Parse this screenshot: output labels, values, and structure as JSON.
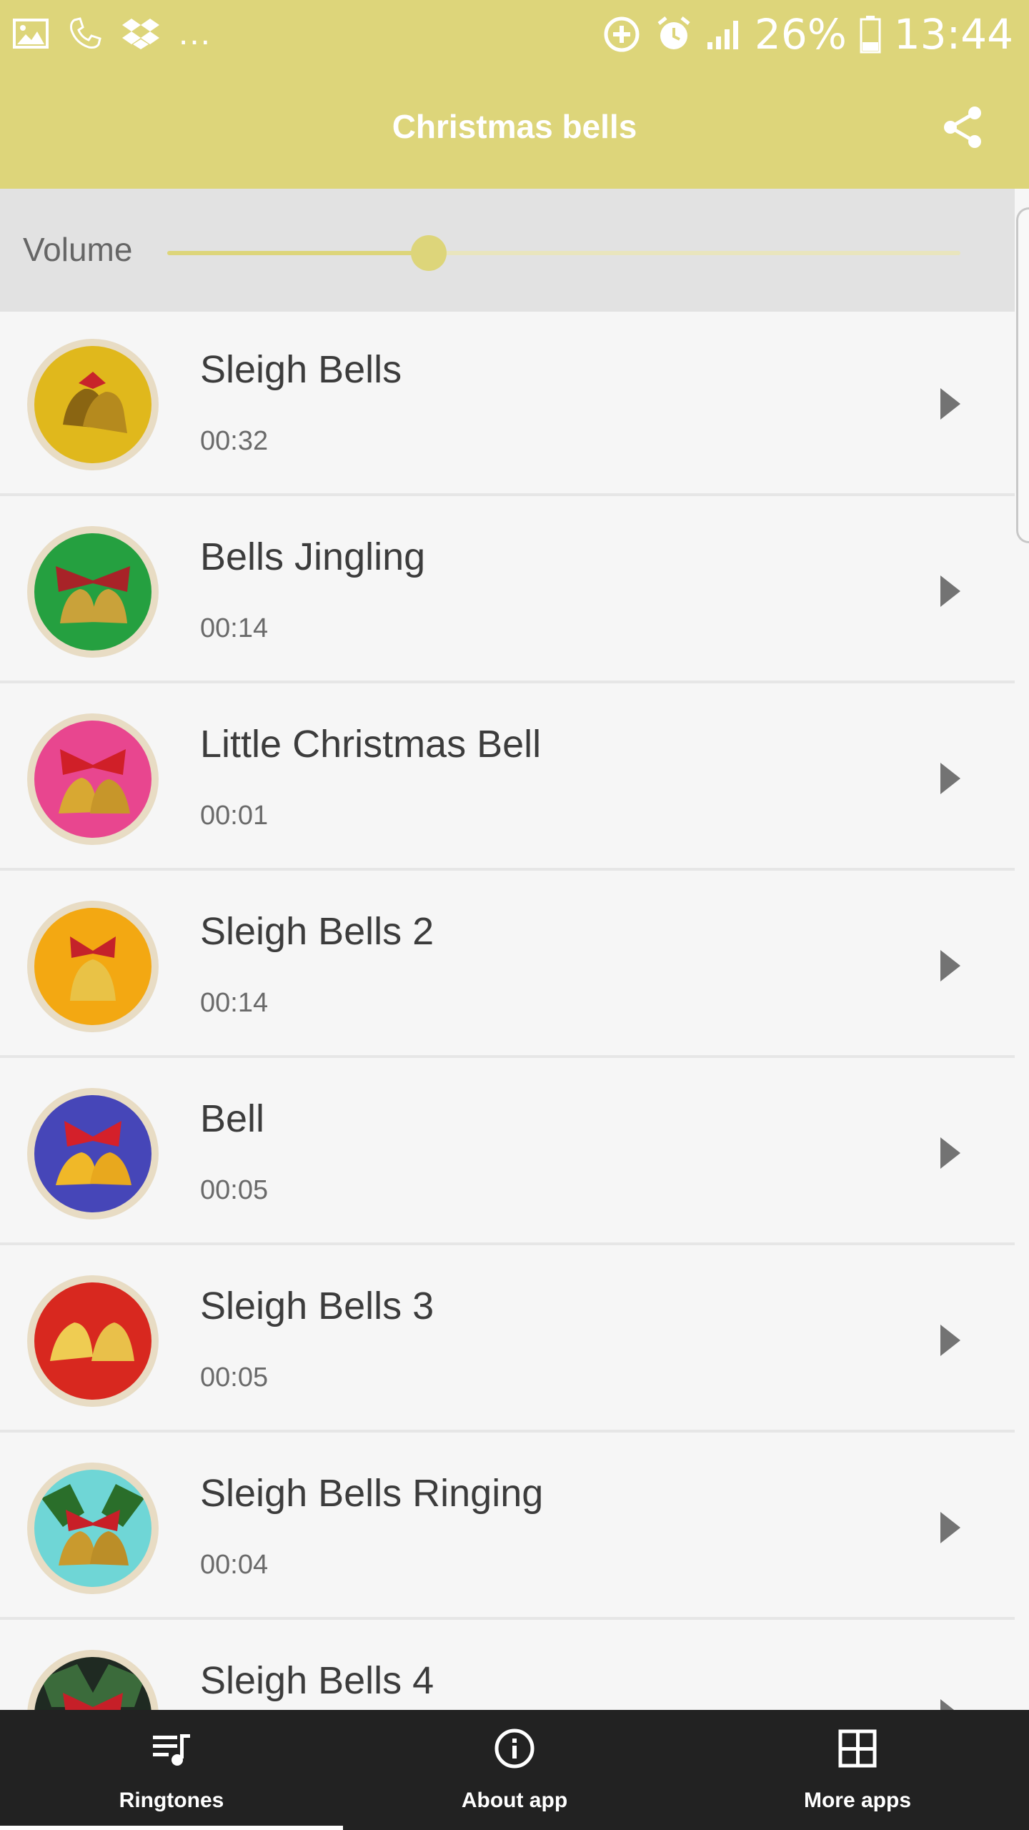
{
  "status_bar": {
    "battery": "26%",
    "time": "13:44",
    "left_icons": [
      "gallery-icon",
      "call-icon",
      "dropbox-icon"
    ],
    "right_icons": [
      "sync-icon",
      "alarm-icon",
      "signal-icon",
      "battery-icon"
    ],
    "more": "..."
  },
  "toolbar": {
    "title": "Christmas bells",
    "share_icon": "share-icon"
  },
  "volume": {
    "label": "Volume",
    "level": 0.33
  },
  "ringtones": [
    {
      "title": "Sleigh Bells",
      "duration": "00:32"
    },
    {
      "title": "Bells Jingling",
      "duration": "00:14"
    },
    {
      "title": "Little Christmas Bell",
      "duration": "00:01"
    },
    {
      "title": "Sleigh Bells 2",
      "duration": "00:14"
    },
    {
      "title": "Bell",
      "duration": "00:05"
    },
    {
      "title": "Sleigh Bells 3",
      "duration": "00:05"
    },
    {
      "title": "Sleigh Bells Ringing",
      "duration": "00:04"
    },
    {
      "title": "Sleigh Bells 4",
      "duration": ""
    }
  ],
  "bottom_nav": {
    "tabs": [
      {
        "label": "Ringtones",
        "icon": "playlist-icon",
        "active": true
      },
      {
        "label": "About app",
        "icon": "info-icon",
        "active": false
      },
      {
        "label": "More apps",
        "icon": "grid-icon",
        "active": false
      }
    ]
  },
  "colors": {
    "accent": "#ddd57a",
    "nav_background": "#222222"
  }
}
